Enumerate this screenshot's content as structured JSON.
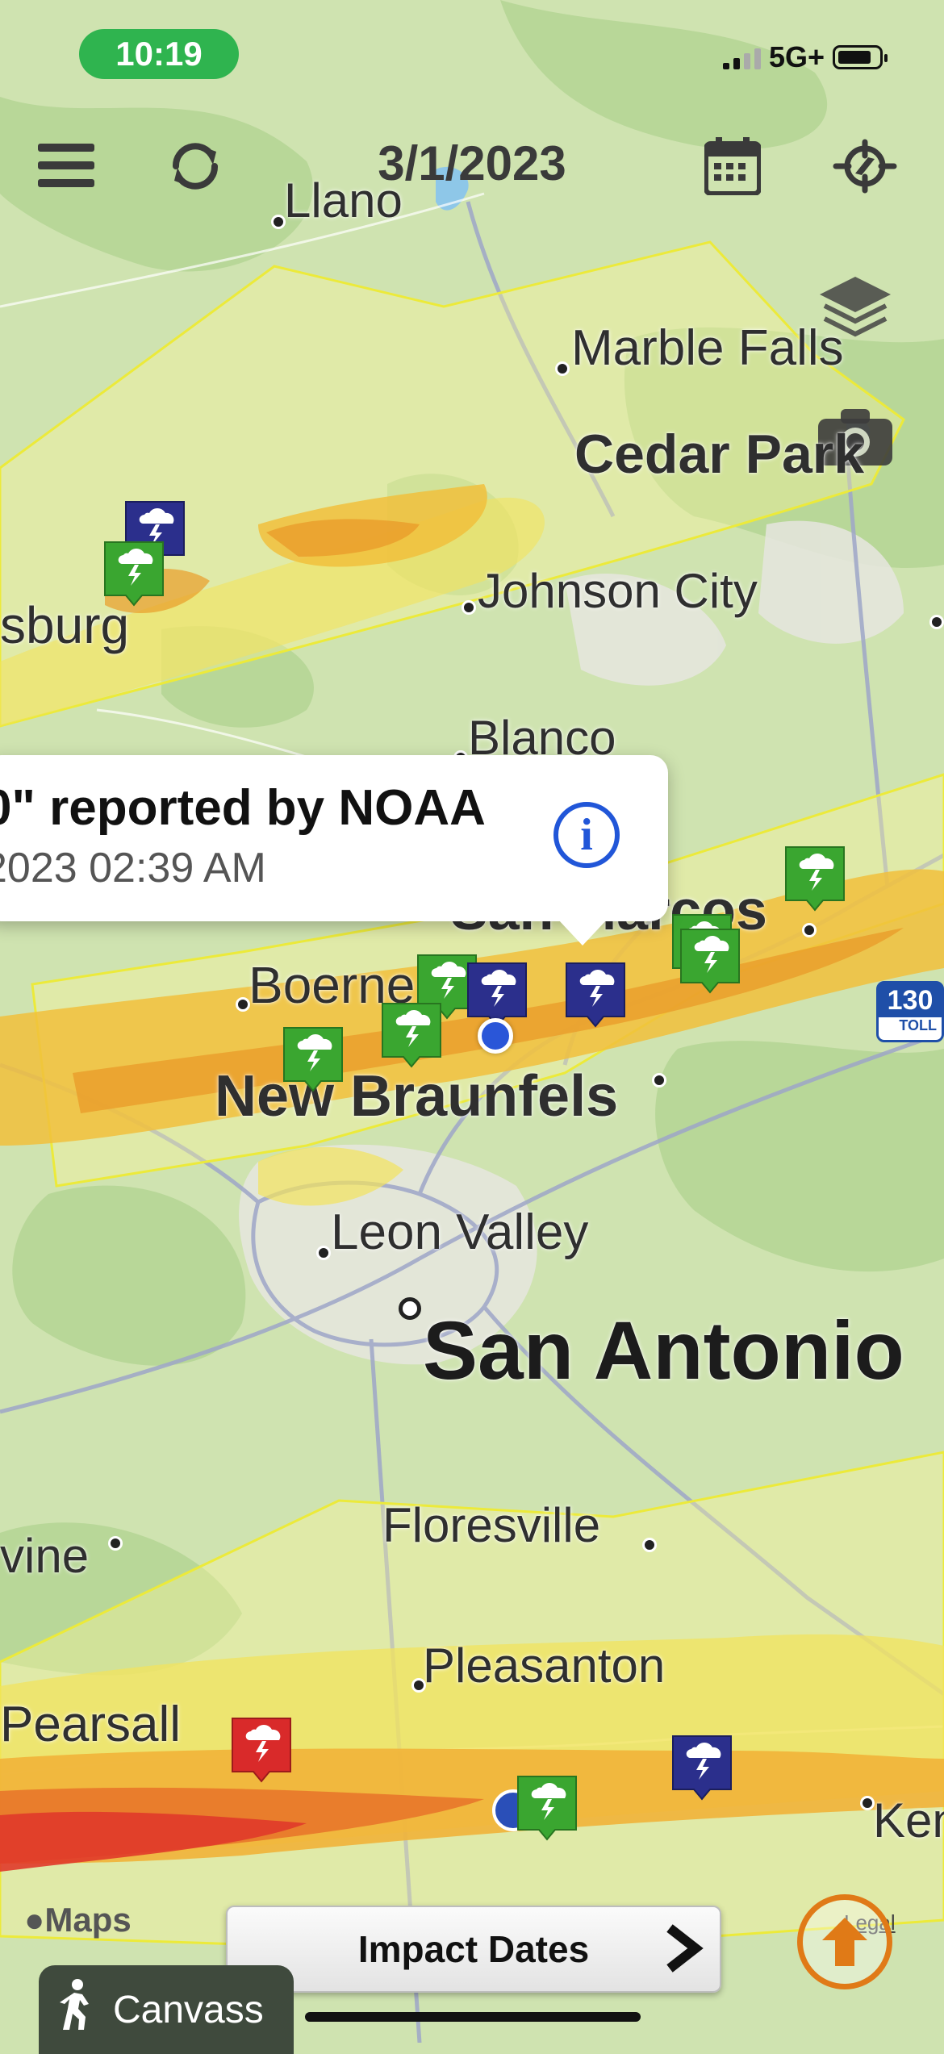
{
  "status_bar": {
    "time": "10:19",
    "network": "5G+"
  },
  "toolbar": {
    "date": "3/1/2023"
  },
  "map": {
    "attribution": "Maps",
    "legal": "Legal",
    "highway_shield": "130",
    "highway_toll": "TOLL",
    "cities": [
      {
        "name": "Llano"
      },
      {
        "name": "Marble Falls"
      },
      {
        "name": "Cedar Park"
      },
      {
        "name": "sburg"
      },
      {
        "name": "Johnson City"
      },
      {
        "name": "Blanco"
      },
      {
        "name": "San Marcos"
      },
      {
        "name": "Boerne"
      },
      {
        "name": "New Braunfels"
      },
      {
        "name": "Leon Valley"
      },
      {
        "name": "San Antonio"
      },
      {
        "name": "Floresville"
      },
      {
        "name": "vine"
      },
      {
        "name": "Pleasanton"
      },
      {
        "name": "Pearsall"
      },
      {
        "name": "Ken"
      }
    ]
  },
  "callout": {
    "title": "0\" reported by NOAA",
    "time": "2023 02:39 AM",
    "info_label": "i"
  },
  "bottom": {
    "impact_dates_label": "Impact Dates",
    "canvass_label": "Canvass"
  },
  "colors": {
    "status_green": "#2fb44f",
    "marker_green": "#3aa630",
    "marker_navy": "#2b2f8c",
    "marker_red": "#d92a2a",
    "accent_orange": "#e07a17",
    "info_blue": "#2156d8"
  },
  "icons": [
    "menu-icon",
    "refresh-icon",
    "calendar-icon",
    "locate-icon",
    "layers-icon",
    "camera-icon",
    "chevron-right-icon",
    "walking-person-icon",
    "arrow-up-icon",
    "storm-icon"
  ]
}
